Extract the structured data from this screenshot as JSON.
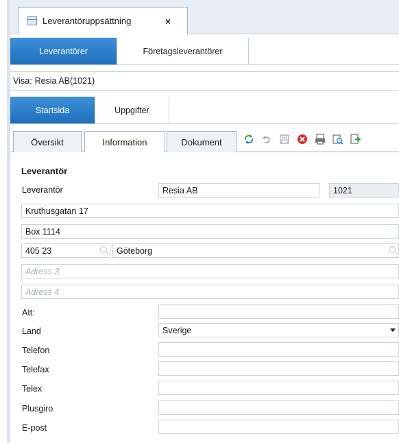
{
  "doc_tab": {
    "title": "Leverantöruppsättning",
    "close": "×"
  },
  "tabs_row1": [
    {
      "label": "Leverantörer",
      "active": true
    },
    {
      "label": "Företagsleverantörer",
      "active": false
    }
  ],
  "visa": {
    "label": "Visa:",
    "value": "Resia AB(1021)"
  },
  "tabs_row2": [
    {
      "label": "Startsida",
      "active": true
    },
    {
      "label": "Uppgifter",
      "active": false
    }
  ],
  "subtabs": [
    {
      "label": "Översikt",
      "active": false
    },
    {
      "label": "Information",
      "active": true
    },
    {
      "label": "Dokument",
      "active": false
    }
  ],
  "toolbar_icons": [
    "refresh-icon",
    "undo-icon",
    "save-icon",
    "delete-icon",
    "print-icon",
    "preview-icon",
    "export-icon"
  ],
  "form": {
    "section_title": "Leverantör",
    "leverantor_label": "Leverantör",
    "leverantor_name": "Resia AB",
    "leverantor_nr": "1021",
    "address1": "Kruthusgatan 17",
    "address2": "Box 1114",
    "postnr": "405 23",
    "city": "Göteborg",
    "address3_placeholder": "Adress 3",
    "address4_placeholder": "Adress 4",
    "att_label": "Att:",
    "att_value": "",
    "land_label": "Land",
    "land_value": "Sverige",
    "telefon_label": "Telefon",
    "telefax_label": "Telefax",
    "telex_label": "Telex",
    "plusgiro_label": "Plusgiro",
    "epost_label": "E-post"
  }
}
